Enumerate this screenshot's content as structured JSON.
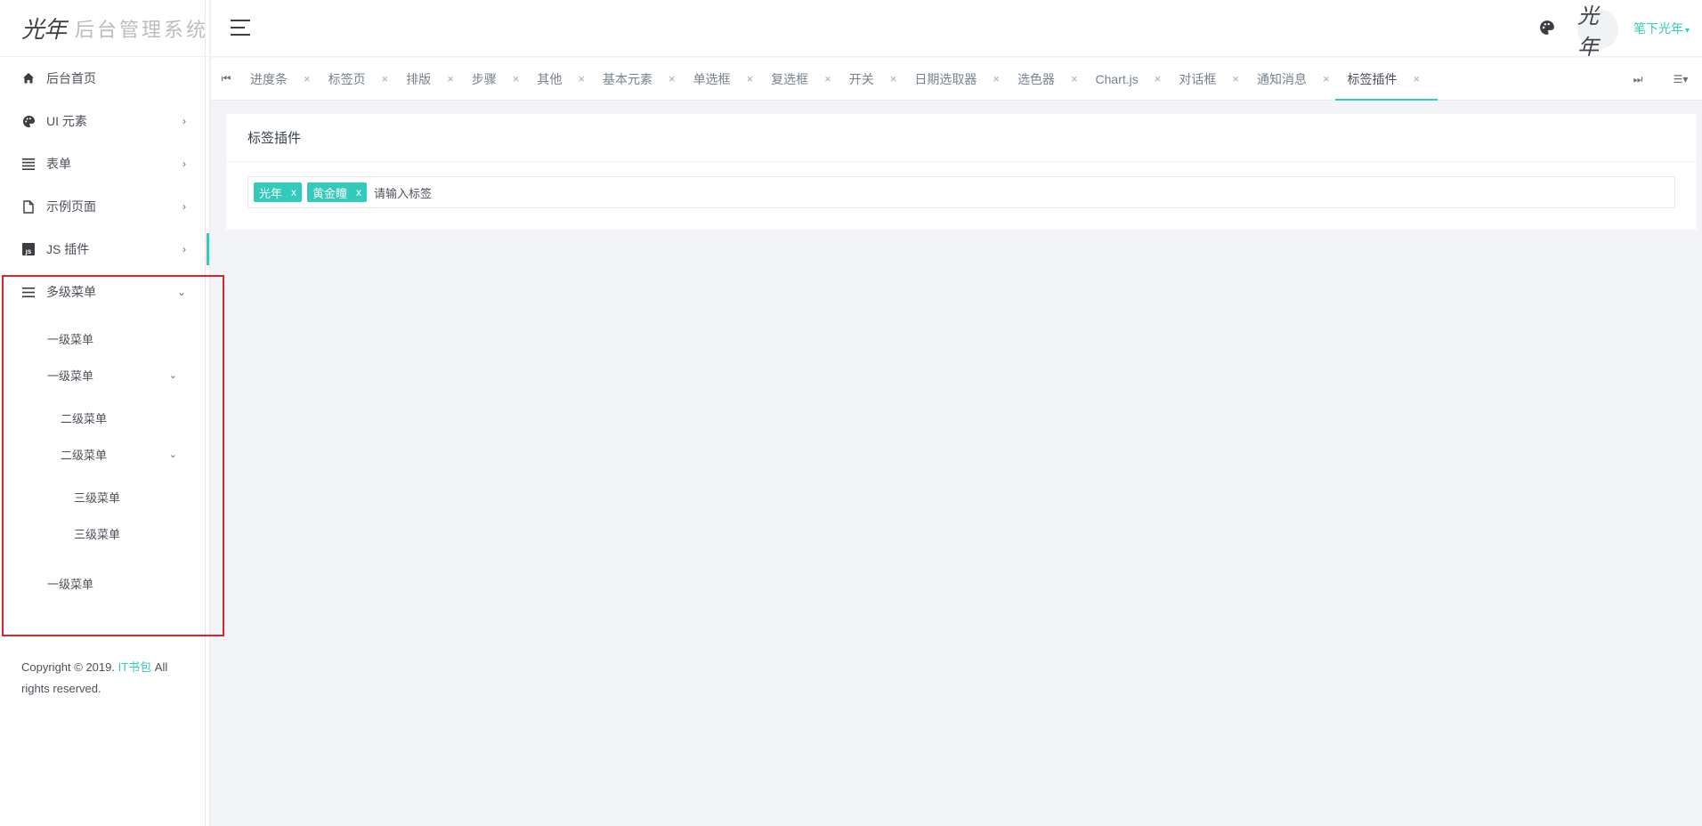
{
  "brand": {
    "logo_glyph": "光年",
    "title": "后台管理系统"
  },
  "sidebar": {
    "items": [
      {
        "label": "后台首页",
        "icon": "home-icon"
      },
      {
        "label": "UI 元素",
        "icon": "palette-icon"
      },
      {
        "label": "表单",
        "icon": "list-icon"
      },
      {
        "label": "示例页面",
        "icon": "file-icon"
      },
      {
        "label": "JS 插件",
        "icon": "js-icon"
      },
      {
        "label": "多级菜单",
        "icon": "menu-icon"
      }
    ],
    "multilevel": {
      "l1_a": "一级菜单",
      "l1_b": "一级菜单",
      "l2_a": "二级菜单",
      "l2_b": "二级菜单",
      "l3_a": "三级菜单",
      "l3_b": "三级菜单",
      "l1_c": "一级菜单"
    },
    "copyright_prefix": "Copyright © 2019. ",
    "copyright_link": "IT书包",
    "copyright_suffix": " All rights reserved."
  },
  "header": {
    "username": "笔下光年",
    "avatar_glyph": "光年"
  },
  "tabs": [
    {
      "label": "进度条"
    },
    {
      "label": "标签页"
    },
    {
      "label": "排版"
    },
    {
      "label": "步骤"
    },
    {
      "label": "其他"
    },
    {
      "label": "基本元素"
    },
    {
      "label": "单选框"
    },
    {
      "label": "复选框"
    },
    {
      "label": "开关"
    },
    {
      "label": "日期选取器"
    },
    {
      "label": "选色器"
    },
    {
      "label": "Chart.js"
    },
    {
      "label": "对话框"
    },
    {
      "label": "通知消息"
    },
    {
      "label": "标签插件",
      "active": true
    }
  ],
  "tab_close_glyph": "×",
  "card": {
    "title": "标签插件",
    "tags": [
      "光年",
      "黄金瞳"
    ],
    "tag_remove_glyph": "x",
    "input_placeholder": "请输入标签"
  },
  "colors": {
    "accent": "#33cabb",
    "highlight_box": "#d9232d"
  }
}
